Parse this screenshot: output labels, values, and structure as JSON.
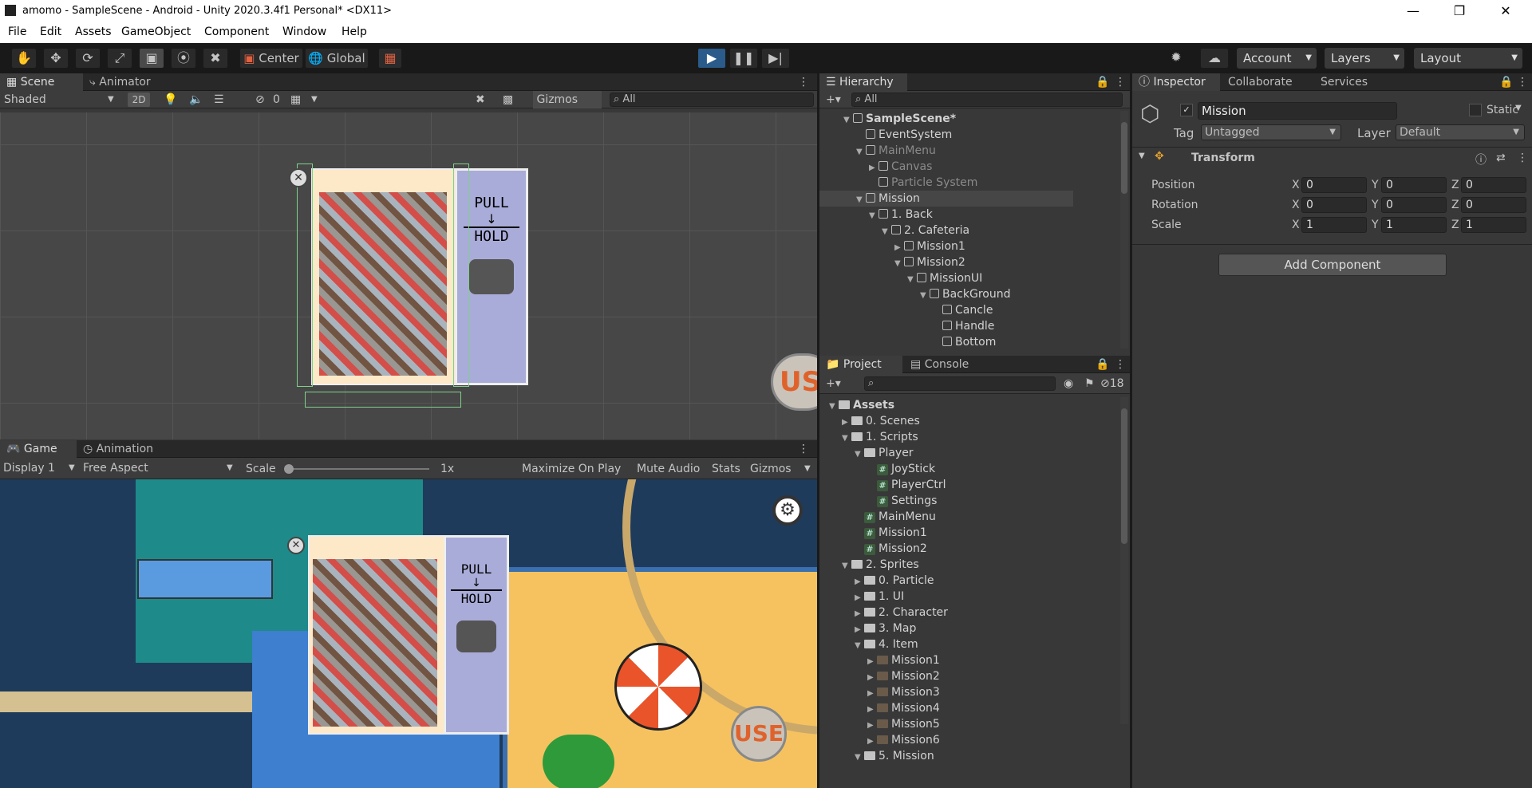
{
  "window": {
    "title": "amomo - SampleScene - Android - Unity 2020.3.4f1 Personal* <DX11>"
  },
  "menu": [
    "File",
    "Edit",
    "Assets",
    "GameObject",
    "Component",
    "Window",
    "Help"
  ],
  "toolbar": {
    "center": "Center",
    "global": "Global",
    "account": "Account",
    "layers": "Layers",
    "layout": "Layout"
  },
  "scene": {
    "tabs": [
      "Scene",
      "Animator"
    ],
    "shading": "Shaded",
    "mode2d": "2D",
    "hidden_count": "0",
    "gizmos": "Gizmos",
    "search_placeholder": "All"
  },
  "game": {
    "tabs": [
      "Game",
      "Animation"
    ],
    "display": "Display 1",
    "aspect": "Free Aspect",
    "scale_label": "Scale",
    "scale_value": "1x",
    "buttons": [
      "Maximize On Play",
      "Mute Audio",
      "Stats",
      "Gizmos"
    ]
  },
  "art": {
    "pull": "PULL",
    "hold": "HOLD",
    "use": "USE"
  },
  "hierarchy": {
    "tab": "Hierarchy",
    "search_placeholder": "All",
    "items": [
      {
        "label": "SampleScene*",
        "depth": 0,
        "kind": "scene",
        "open": true,
        "dim": false,
        "sel": false
      },
      {
        "label": "EventSystem",
        "depth": 1,
        "kind": "go",
        "open": null,
        "dim": false,
        "sel": false
      },
      {
        "label": "MainMenu",
        "depth": 1,
        "kind": "go",
        "open": true,
        "dim": true,
        "sel": false
      },
      {
        "label": "Canvas",
        "depth": 2,
        "kind": "go",
        "open": false,
        "dim": true,
        "sel": false
      },
      {
        "label": "Particle System",
        "depth": 2,
        "kind": "go",
        "open": null,
        "dim": true,
        "sel": false
      },
      {
        "label": "Mission",
        "depth": 1,
        "kind": "go",
        "open": true,
        "dim": false,
        "sel": true
      },
      {
        "label": "1. Back",
        "depth": 2,
        "kind": "go",
        "open": true,
        "dim": false,
        "sel": false
      },
      {
        "label": "2. Cafeteria",
        "depth": 3,
        "kind": "go",
        "open": true,
        "dim": false,
        "sel": false
      },
      {
        "label": "Mission1",
        "depth": 4,
        "kind": "go",
        "open": false,
        "dim": false,
        "sel": false
      },
      {
        "label": "Mission2",
        "depth": 4,
        "kind": "go",
        "open": true,
        "dim": false,
        "sel": false
      },
      {
        "label": "MissionUI",
        "depth": 5,
        "kind": "go",
        "open": true,
        "dim": false,
        "sel": false
      },
      {
        "label": "BackGround",
        "depth": 6,
        "kind": "go",
        "open": true,
        "dim": false,
        "sel": false
      },
      {
        "label": "Cancle",
        "depth": 7,
        "kind": "go",
        "open": null,
        "dim": false,
        "sel": false
      },
      {
        "label": "Handle",
        "depth": 7,
        "kind": "go",
        "open": null,
        "dim": false,
        "sel": false
      },
      {
        "label": "Bottom",
        "depth": 7,
        "kind": "go",
        "open": null,
        "dim": false,
        "sel": false
      }
    ]
  },
  "project": {
    "tabs": [
      "Project",
      "Console"
    ],
    "hidden_count": "18",
    "items": [
      {
        "label": "Assets",
        "depth": 0,
        "kind": "folder",
        "open": true
      },
      {
        "label": "0. Scenes",
        "depth": 1,
        "kind": "folder",
        "open": false
      },
      {
        "label": "1. Scripts",
        "depth": 1,
        "kind": "folder",
        "open": true
      },
      {
        "label": "Player",
        "depth": 2,
        "kind": "folder",
        "open": true
      },
      {
        "label": "JoyStick",
        "depth": 3,
        "kind": "script",
        "open": null
      },
      {
        "label": "PlayerCtrl",
        "depth": 3,
        "kind": "script",
        "open": null
      },
      {
        "label": "Settings",
        "depth": 3,
        "kind": "script",
        "open": null
      },
      {
        "label": "MainMenu",
        "depth": 2,
        "kind": "script",
        "open": null
      },
      {
        "label": "Mission1",
        "depth": 2,
        "kind": "script",
        "open": null
      },
      {
        "label": "Mission2",
        "depth": 2,
        "kind": "script",
        "open": null
      },
      {
        "label": "2. Sprites",
        "depth": 1,
        "kind": "folder",
        "open": true
      },
      {
        "label": "0. Particle",
        "depth": 2,
        "kind": "folder",
        "open": false
      },
      {
        "label": "1. UI",
        "depth": 2,
        "kind": "folder",
        "open": false
      },
      {
        "label": "2. Character",
        "depth": 2,
        "kind": "folder",
        "open": false
      },
      {
        "label": "3. Map",
        "depth": 2,
        "kind": "folder",
        "open": false
      },
      {
        "label": "4. Item",
        "depth": 2,
        "kind": "folder",
        "open": true
      },
      {
        "label": "Mission1",
        "depth": 3,
        "kind": "sprite",
        "open": false
      },
      {
        "label": "Mission2",
        "depth": 3,
        "kind": "sprite",
        "open": false
      },
      {
        "label": "Mission3",
        "depth": 3,
        "kind": "sprite",
        "open": false
      },
      {
        "label": "Mission4",
        "depth": 3,
        "kind": "sprite",
        "open": false
      },
      {
        "label": "Mission5",
        "depth": 3,
        "kind": "sprite",
        "open": false
      },
      {
        "label": "Mission6",
        "depth": 3,
        "kind": "sprite",
        "open": false
      },
      {
        "label": "5. Mission",
        "depth": 2,
        "kind": "folder",
        "open": true
      }
    ]
  },
  "inspector": {
    "tabs": [
      "Inspector",
      "Collaborate",
      "Services"
    ],
    "object_name": "Mission",
    "static_label": "Static",
    "tag_label": "Tag",
    "tag_value": "Untagged",
    "layer_label": "Layer",
    "layer_value": "Default",
    "component": "Transform",
    "rows": [
      {
        "label": "Position",
        "x": "0",
        "y": "0",
        "z": "0"
      },
      {
        "label": "Rotation",
        "x": "0",
        "y": "0",
        "z": "0"
      },
      {
        "label": "Scale",
        "x": "1",
        "y": "1",
        "z": "1"
      }
    ],
    "add_component": "Add Component",
    "axis": [
      "X",
      "Y",
      "Z"
    ]
  }
}
